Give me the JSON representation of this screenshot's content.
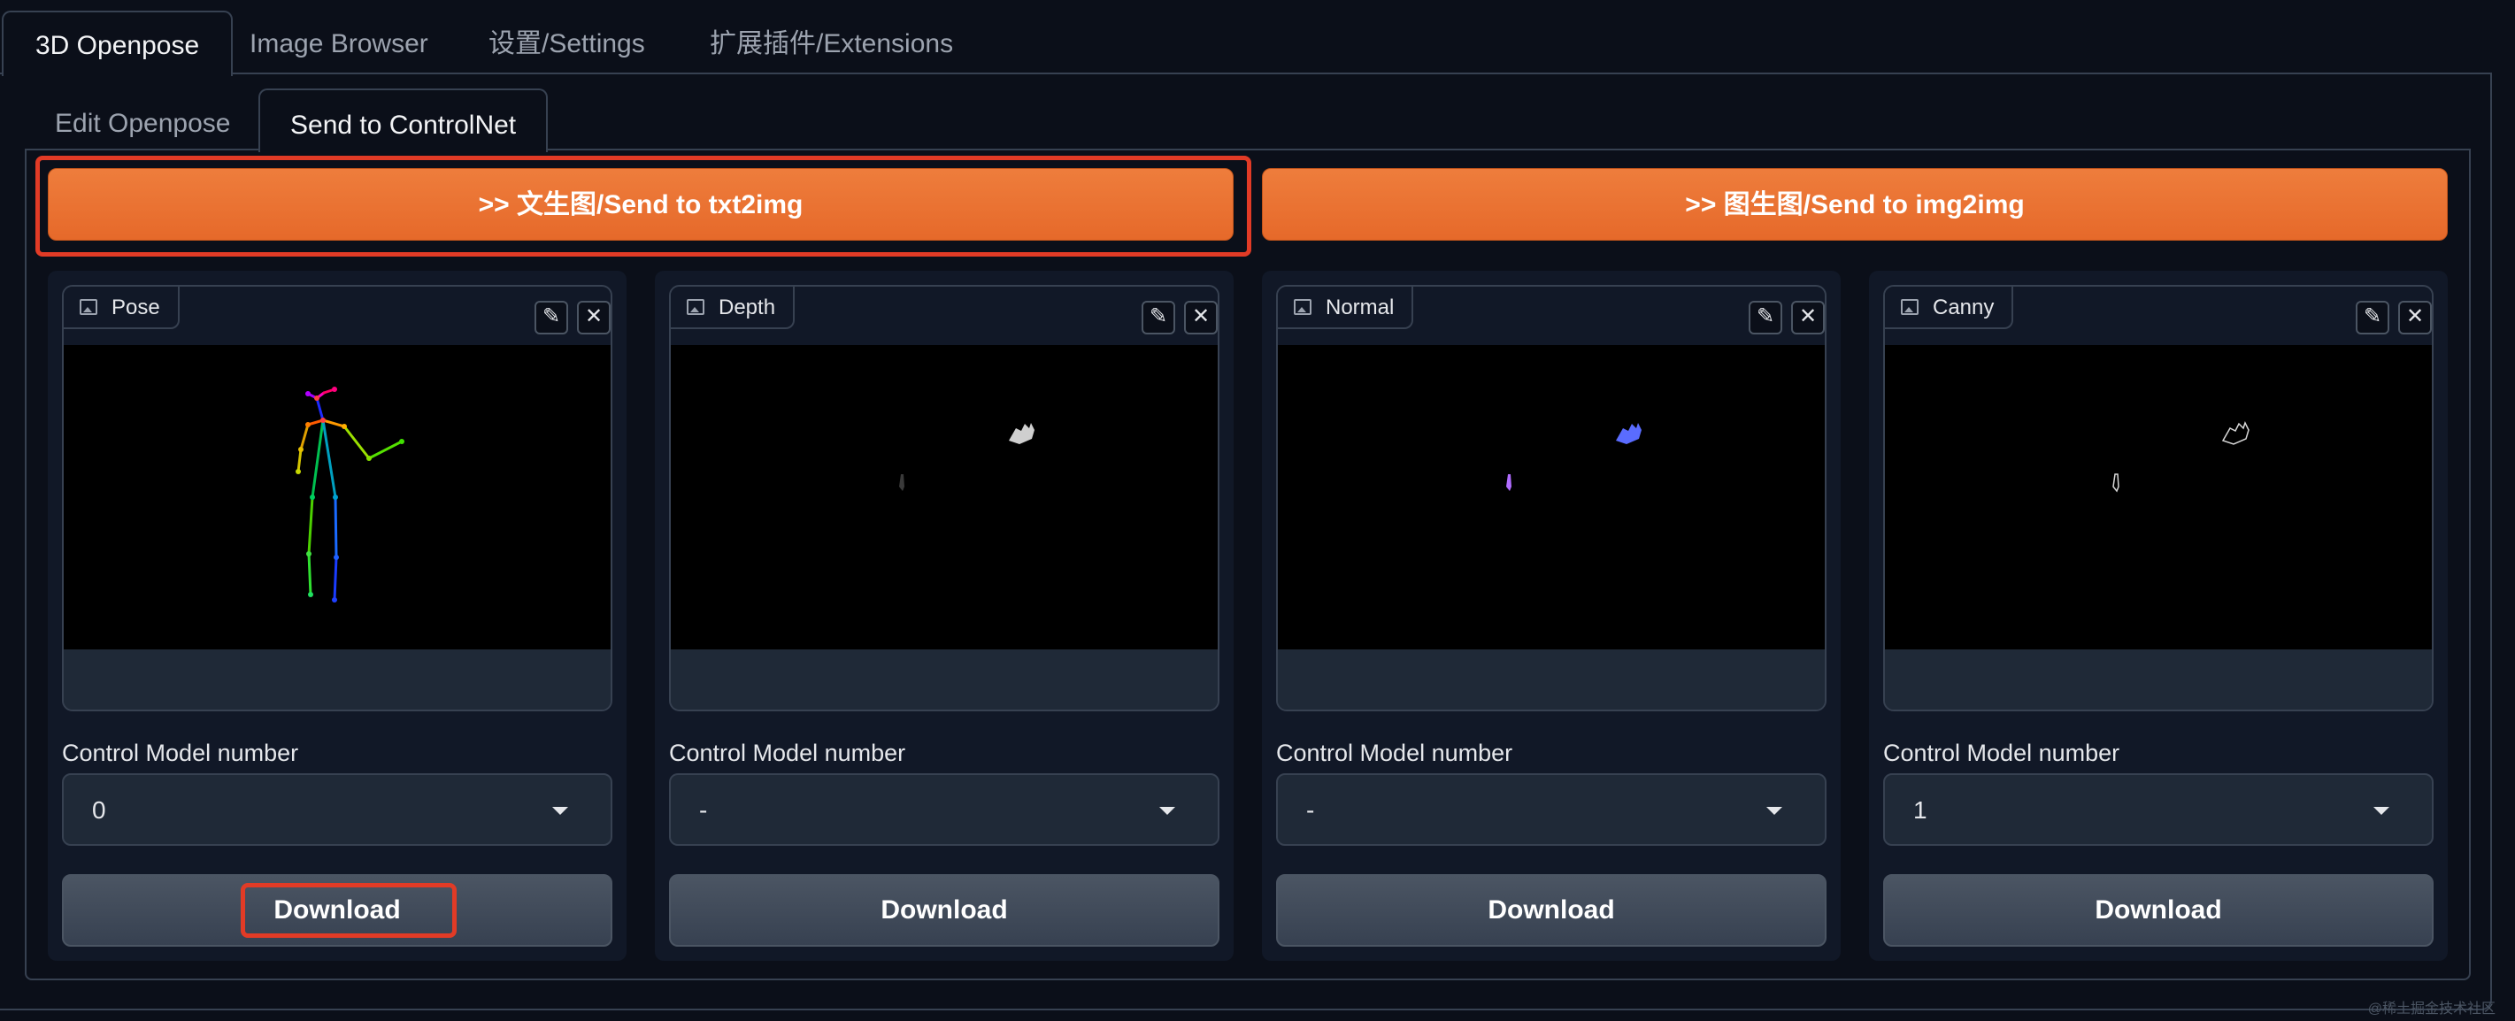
{
  "top_tabs": [
    {
      "label": "3D Openpose",
      "active": true
    },
    {
      "label": "Image Browser",
      "active": false
    },
    {
      "label": "设置/Settings",
      "active": false
    },
    {
      "label": "扩展插件/Extensions",
      "active": false
    }
  ],
  "sub_tabs": [
    {
      "label": "Edit Openpose",
      "active": false
    },
    {
      "label": "Send to ControlNet",
      "active": true
    }
  ],
  "send_buttons": {
    "txt2img": ">> 文生图/Send to txt2img",
    "img2img": ">> 图生图/Send to img2img"
  },
  "cards": [
    {
      "title": "Pose",
      "control_label": "Control Model number",
      "control_value": "0",
      "download_label": "Download"
    },
    {
      "title": "Depth",
      "control_label": "Control Model number",
      "control_value": "-",
      "download_label": "Download"
    },
    {
      "title": "Normal",
      "control_label": "Control Model number",
      "control_value": "-",
      "download_label": "Download"
    },
    {
      "title": "Canny",
      "control_label": "Control Model number",
      "control_value": "1",
      "download_label": "Download"
    }
  ],
  "icons": {
    "image_label": "image-icon",
    "edit": "pencil-icon",
    "clear": "close-icon",
    "dropdown": "chevron-down-icon"
  },
  "colors": {
    "accent_orange": "#e6692a",
    "highlight_red": "#e23b26",
    "background": "#0b0f19"
  },
  "watermark": "@稀土掘金技术社区"
}
